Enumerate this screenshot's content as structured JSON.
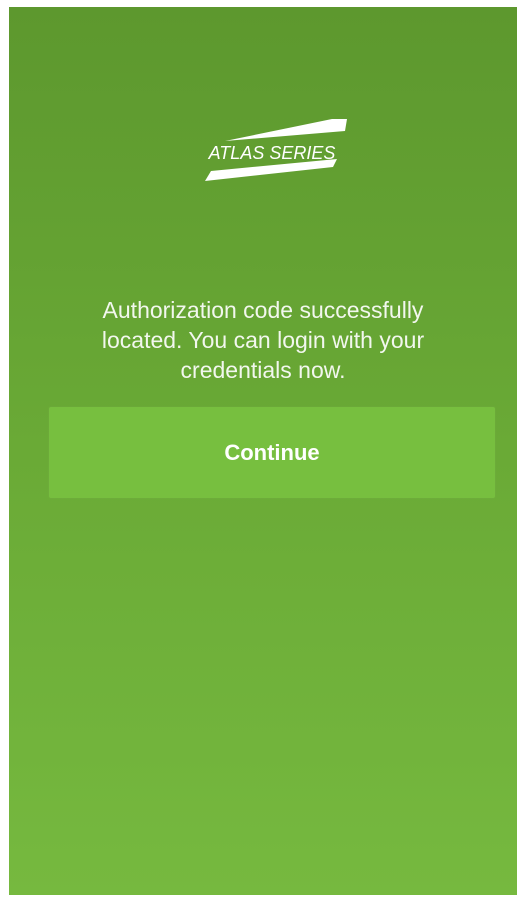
{
  "logo": {
    "text": "ATLAS SERIES",
    "icon": "atlas-series-logo"
  },
  "message": {
    "lines": [
      "Authorization code successfully",
      "located. You can login with your",
      "credentials now."
    ]
  },
  "continue_button": {
    "label": "Continue"
  },
  "colors": {
    "background_top": "#5d982e",
    "background_bottom": "#76b93f",
    "button": "#77bf3f",
    "text": "#ffffff"
  }
}
